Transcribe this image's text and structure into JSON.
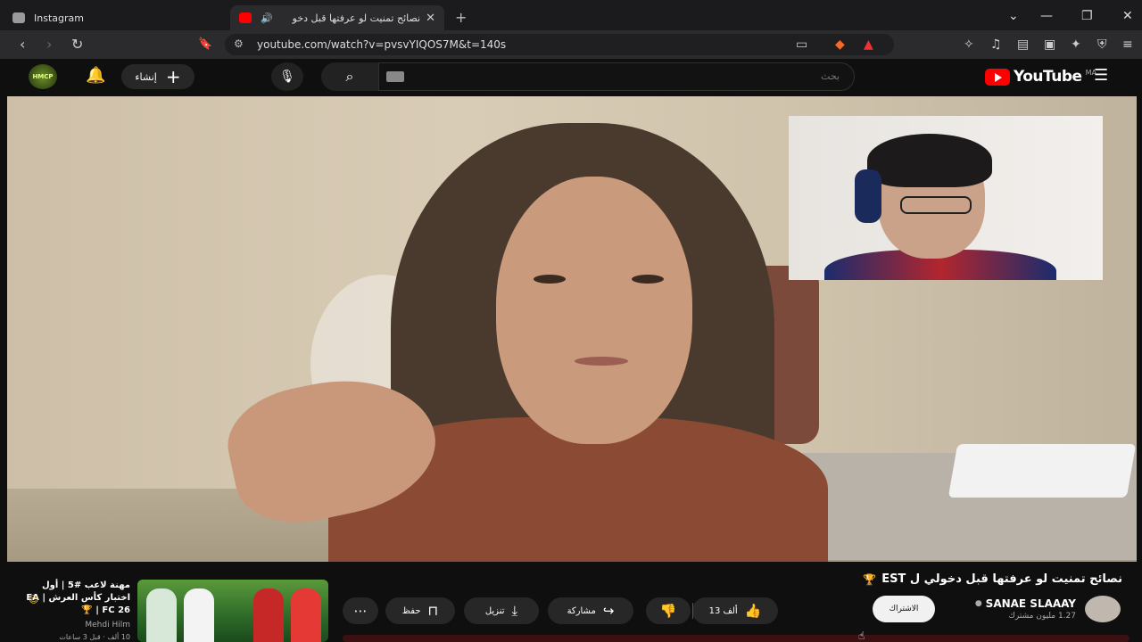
{
  "browser": {
    "tabs": [
      {
        "title": "Instagram",
        "active": false
      },
      {
        "title": "نصائح تمنيت لو عرفتها قبل دخو",
        "active": true
      }
    ],
    "new_tab_label": "+",
    "url": "youtube.com/watch?v=pvsvYIQOS7M&t=140s"
  },
  "youtube": {
    "avatar_text": "HMCP",
    "create_label": "إنشاء",
    "search_placeholder": "بحث",
    "logo_text": "YouTube",
    "region": "MA"
  },
  "video": {
    "title": "نصائح تمنيت لو عرفتها قبل دخولي ل EST",
    "channel_name": "SANAE SLAAAY",
    "subscribers": "1.27 مليون مشترك",
    "subscribe_label": "الاشتراك",
    "like_count": "13 ألف",
    "share_label": "مشاركة",
    "download_label": "تنزيل",
    "save_label": "حفظ"
  },
  "recommendation": {
    "title": "مهنة لاعب #5 | أول اختبار كأس العرش | EA FC 26 | 🏆",
    "channel": "Mehdi Hilm",
    "meta": "10 ألف · قبل 3 ساعات"
  },
  "colors": {
    "accent": "#ff0000",
    "background": "#0f0f0f",
    "pill": "#272727"
  }
}
